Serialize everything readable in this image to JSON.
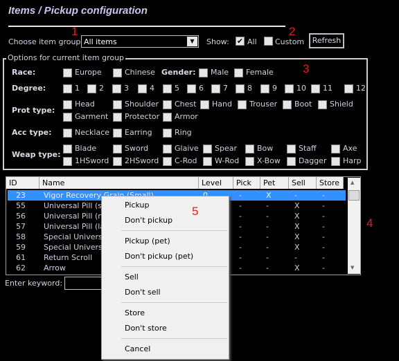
{
  "title": "Items / Pickup configuration",
  "annotations": [
    "1",
    "2",
    "3",
    "4",
    "5"
  ],
  "toolbar": {
    "choose_label": "Choose item group:",
    "group_value": "All items",
    "show_label": "Show:",
    "all_label": "All",
    "all_checked": true,
    "custom_label": "Custom",
    "custom_checked": false,
    "refresh_label": "Refresh"
  },
  "options": {
    "legend": "Options for current item group",
    "race": {
      "label": "Race:",
      "items": [
        "Europe",
        "Chinese"
      ]
    },
    "gender": {
      "label": "Gender:",
      "items": [
        "Male",
        "Female"
      ]
    },
    "degree": {
      "label": "Degree:",
      "items": [
        "1",
        "2",
        "3",
        "4",
        "5",
        "6",
        "7",
        "8",
        "9",
        "10",
        "11",
        "12"
      ]
    },
    "prot": {
      "label": "Prot type:",
      "items": [
        "Head",
        "Shoulder",
        "Chest",
        "Hand",
        "Trouser",
        "Boot",
        "Shield",
        "Garment",
        "Protector",
        "Armor"
      ]
    },
    "acc": {
      "label": "Acc type:",
      "items": [
        "Necklace",
        "Earring",
        "Ring"
      ]
    },
    "weap": {
      "label": "Weap type:",
      "items": [
        "Blade",
        "Sword",
        "Glaive",
        "Spear",
        "Bow",
        "Staff",
        "Axe",
        "1HSword",
        "2HSword",
        "C-Rod",
        "W-Rod",
        "X-Bow",
        "Dagger",
        "Harp"
      ]
    }
  },
  "table": {
    "columns": [
      "ID",
      "Name",
      "Level",
      "Pick",
      "Pet",
      "Sell",
      "Store"
    ],
    "rows": [
      {
        "id": "23",
        "name": "Vigor Recovery Grain (Small)",
        "level": "0",
        "pick": "-",
        "pet": "X",
        "sell": "-",
        "store": "-",
        "selected": true
      },
      {
        "id": "55",
        "name": "Universal Pill (sm",
        "level": "",
        "pick": "-",
        "pet": "-",
        "sell": "X",
        "store": "-"
      },
      {
        "id": "56",
        "name": "Universal Pill (me",
        "level": "",
        "pick": "-",
        "pet": "-",
        "sell": "X",
        "store": "-"
      },
      {
        "id": "57",
        "name": "Universal Pill (lar",
        "level": "",
        "pick": "-",
        "pet": "-",
        "sell": "X",
        "store": "-"
      },
      {
        "id": "58",
        "name": "Special Universa",
        "level": "",
        "pick": "-",
        "pet": "-",
        "sell": "X",
        "store": "-"
      },
      {
        "id": "59",
        "name": "Special Universa",
        "level": "",
        "pick": "-",
        "pet": "-",
        "sell": "X",
        "store": "-"
      },
      {
        "id": "61",
        "name": "Return Scroll",
        "level": "",
        "pick": "-",
        "pet": "-",
        "sell": "-",
        "store": "-"
      },
      {
        "id": "62",
        "name": "Arrow",
        "level": "",
        "pick": "-",
        "pet": "-",
        "sell": "X",
        "store": "-"
      }
    ]
  },
  "keyword": {
    "label": "Enter keyword:",
    "value": ""
  },
  "context_menu": {
    "groups": [
      [
        "Pickup",
        "Don't pickup"
      ],
      [
        "Pickup (pet)",
        "Don't pickup (pet)"
      ],
      [
        "Sell",
        "Don't sell"
      ],
      [
        "Store",
        "Don't store"
      ],
      [
        "Cancel"
      ]
    ]
  },
  "colors": {
    "selection": "#3390ff",
    "title": "#c4c8f0",
    "annotation": "#e02020"
  }
}
